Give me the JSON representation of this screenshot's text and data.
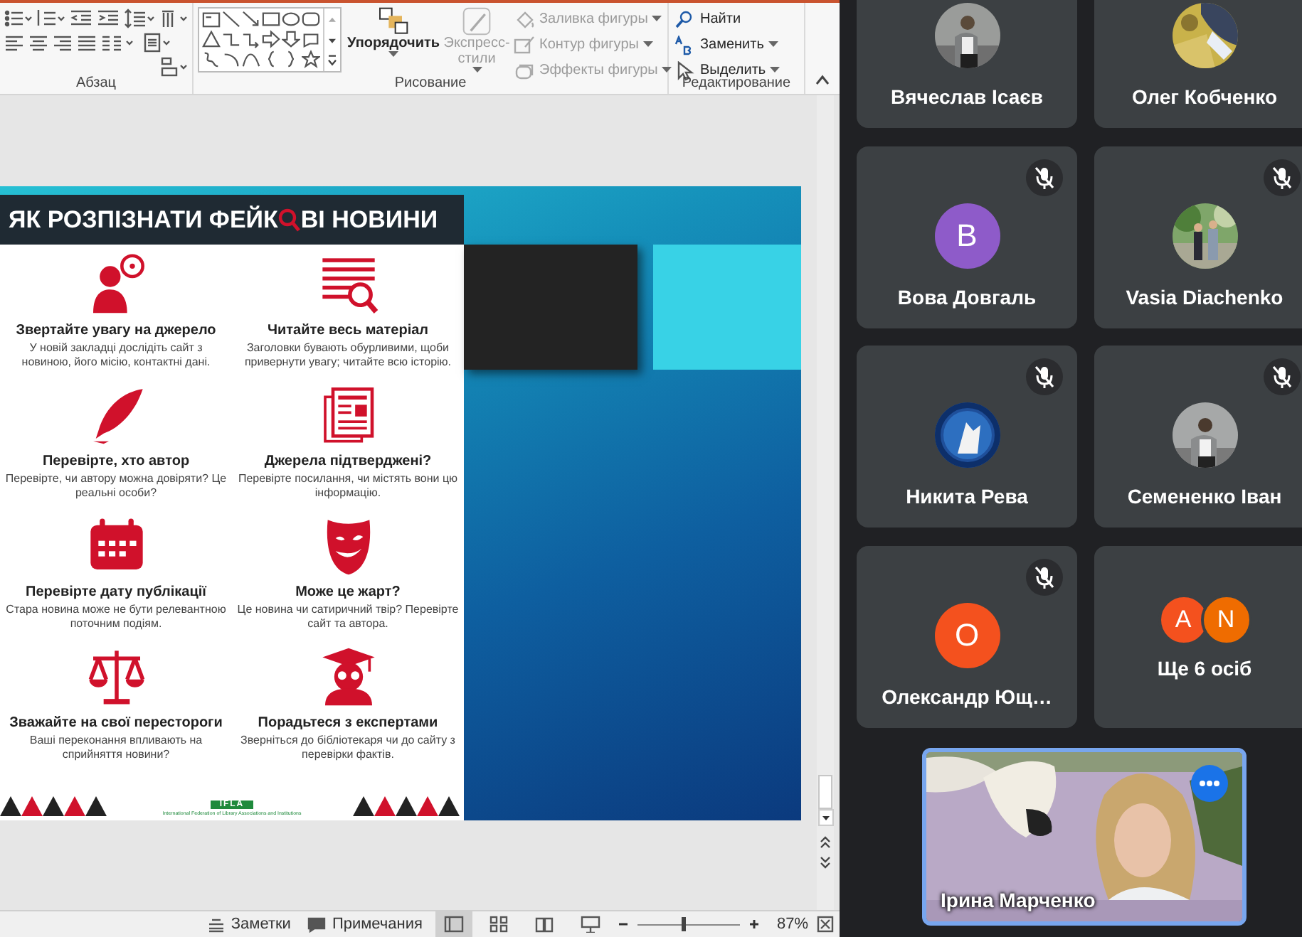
{
  "ribbon": {
    "groups": [
      {
        "label": "Абзац"
      },
      {
        "label": "Рисование"
      },
      {
        "label": "Редактирование"
      }
    ],
    "arrange": {
      "label": "Упорядочить",
      "disabled": false
    },
    "quick_styles": {
      "label": "Экспресс-стили",
      "disabled": true
    },
    "shape_format": [
      {
        "label": "Заливка фигуры",
        "disabled": true
      },
      {
        "label": "Контур фигуры",
        "disabled": true
      },
      {
        "label": "Эффекты фигуры",
        "disabled": true
      }
    ],
    "editing": [
      {
        "label": "Найти",
        "dropdown": false,
        "disabled": false
      },
      {
        "label": "Заменить",
        "dropdown": true,
        "disabled": false
      },
      {
        "label": "Выделить",
        "dropdown": true,
        "disabled": false
      }
    ]
  },
  "slide": {
    "poster": {
      "title_start": "ЯК РОЗПІЗНАТИ ФЕЙК",
      "title_end": "ВІ НОВИНИ",
      "tips": [
        {
          "kind": "source",
          "heading": "Звертайте увагу на джерело",
          "text": "У новій закладці дослідіть сайт з новиною, його місію, контактні дані."
        },
        {
          "kind": "read",
          "heading": "Читайте весь матеріал",
          "text": "Заголовки бувають обурливими, щоби привернути увагу; читайте всю історію."
        },
        {
          "kind": "author",
          "heading": "Перевірте, хто автор",
          "text": "Перевірте, чи автору можна довіряти? Це реальні особи?"
        },
        {
          "kind": "sources",
          "heading": "Джерела підтверджені?",
          "text": "Перевірте посилання, чи містять вони цю інформацію."
        },
        {
          "kind": "date",
          "heading": "Перевірте дату публікації",
          "text": "Стара новина може не бути релевантною поточним подіям."
        },
        {
          "kind": "joke",
          "heading": "Може це жарт?",
          "text": "Це новина чи сатиричний твір? Перевірте сайт та автора."
        },
        {
          "kind": "bias",
          "heading": "Зважайте на свої перестороги",
          "text": "Ваші переконання впливають на сприйняття новини?"
        },
        {
          "kind": "expert",
          "heading": "Порадьтеся з експертами",
          "text": "Зверніться до бібліотекаря чи до сайту з перевірки фактів."
        }
      ],
      "org_logo": "IFLA",
      "org_name": "International Federation of Library Associations and Institutions"
    }
  },
  "status_bar": {
    "notes": "Заметки",
    "comments": "Примечания",
    "views": [
      {
        "kind": "normal",
        "selected": true
      },
      {
        "kind": "sorter",
        "selected": false
      },
      {
        "kind": "reading",
        "selected": false
      },
      {
        "kind": "show",
        "selected": false
      }
    ],
    "zoom": {
      "level": 0.45,
      "reading": "87%"
    }
  },
  "meeting": {
    "tiles": [
      {
        "name": "Вячеслав Ісаєв"
      },
      {
        "name": "Олег Кобченко"
      },
      {
        "kind": "letter",
        "name": "Вова Довгаль",
        "initial": "В",
        "color": "#8e5bc9",
        "muted": true
      },
      {
        "name": "Vasia Diachenko",
        "muted": true
      },
      {
        "name": "Никита Рева",
        "muted": true
      },
      {
        "name": "Семененко Іван",
        "muted": true
      },
      {
        "kind": "letter",
        "name": "Олександр Ющ…",
        "initial": "О",
        "color": "#f4511e",
        "muted": true
      }
    ],
    "others": {
      "initials": [
        {
          "letter": "A",
          "color": "#f4511e"
        },
        {
          "letter": "N",
          "color": "#ef6c00"
        }
      ],
      "label": "Ще 6 осіб"
    },
    "self_view": {
      "name": "Ірина Марченко"
    }
  }
}
